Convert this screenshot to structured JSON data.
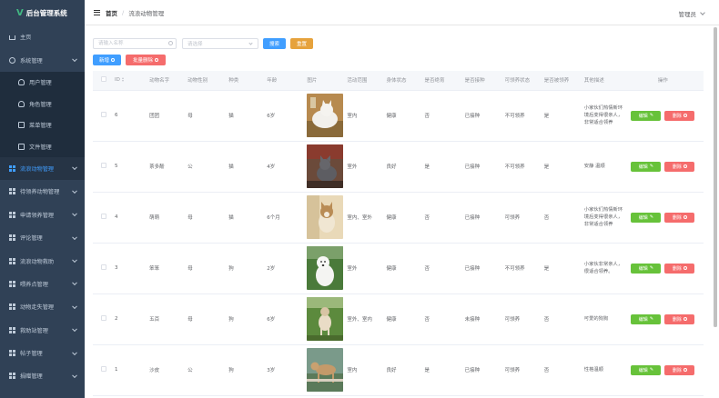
{
  "app": {
    "logo_mark": "V",
    "title": "后台管理系统"
  },
  "sidebar": {
    "items": [
      {
        "label": "主页",
        "icon": "home-icon"
      },
      {
        "label": "系统管理",
        "icon": "gear-icon",
        "expanded": true
      },
      {
        "label": "用户管理",
        "icon": "user-icon",
        "sub": true
      },
      {
        "label": "角色管理",
        "icon": "user-icon",
        "sub": true
      },
      {
        "label": "菜单管理",
        "icon": "doc-icon",
        "sub": true
      },
      {
        "label": "文件管理",
        "icon": "doc-icon",
        "sub": true
      },
      {
        "label": "流浪动物管理",
        "icon": "grid-icon",
        "active": true
      },
      {
        "label": "待领养动物管理",
        "icon": "grid-icon"
      },
      {
        "label": "申请领养管理",
        "icon": "grid-icon"
      },
      {
        "label": "评论管理",
        "icon": "grid-icon"
      },
      {
        "label": "流浪动物救助",
        "icon": "grid-icon"
      },
      {
        "label": "喂养点管理",
        "icon": "grid-icon"
      },
      {
        "label": "动物走失管理",
        "icon": "grid-icon"
      },
      {
        "label": "救助站管理",
        "icon": "grid-icon"
      },
      {
        "label": "帖子管理",
        "icon": "grid-icon"
      },
      {
        "label": "捐赠管理",
        "icon": "grid-icon"
      }
    ]
  },
  "header": {
    "breadcrumb_home": "首页",
    "breadcrumb_sep": "/",
    "breadcrumb_current": "流浪动物管理",
    "user": "管理员"
  },
  "toolbar": {
    "search_placeholder": "请输入名称",
    "select_placeholder": "请选择",
    "search_label": "搜索",
    "reset_label": "重置",
    "add_label": "新增",
    "batch_delete_label": "批量删除"
  },
  "table": {
    "columns": [
      "ID",
      "动物名字",
      "动物性别",
      "种类",
      "年龄",
      "图片",
      "活动范围",
      "身体状态",
      "是否绝育",
      "是否接种",
      "可领养状态",
      "是否被领养",
      "其他描述",
      "操作"
    ],
    "edit_label": "编辑",
    "delete_label": "删除",
    "rows": [
      {
        "id": "6",
        "name": "团团",
        "gender": "母",
        "species": "猫",
        "age": "6岁",
        "photo": "white-cat",
        "range": "室内",
        "health": "健康",
        "neutered": "否",
        "vaccinated": "已接种",
        "adoptable": "不可领养",
        "adopted": "是",
        "desc": "小家伙们热情新环境后变得很亲人，非常适合领养"
      },
      {
        "id": "5",
        "name": "茶多酚",
        "gender": "公",
        "species": "猫",
        "age": "4岁",
        "photo": "grey-cat",
        "range": "室外",
        "health": "良好",
        "neutered": "是",
        "vaccinated": "已接种",
        "adoptable": "不可领养",
        "adopted": "是",
        "desc": "安静 温顺"
      },
      {
        "id": "4",
        "name": "萌萌",
        "gender": "母",
        "species": "猫",
        "age": "6个月",
        "photo": "kitten",
        "range": "室内、室外",
        "health": "健康",
        "neutered": "否",
        "vaccinated": "已接种",
        "adoptable": "可领养",
        "adopted": "否",
        "desc": "小家伙们热情新环境后变得很亲人，非常适合领养"
      },
      {
        "id": "3",
        "name": "笨笨",
        "gender": "母",
        "species": "狗",
        "age": "2岁",
        "photo": "white-dog",
        "range": "室外",
        "health": "健康",
        "neutered": "否",
        "vaccinated": "已接种",
        "adoptable": "不可领养",
        "adopted": "是",
        "desc": "小家伙非常亲人，很适合领养。"
      },
      {
        "id": "2",
        "name": "五百",
        "gender": "母",
        "species": "狗",
        "age": "6岁",
        "photo": "brown-dog",
        "range": "室外、室内",
        "health": "健康",
        "neutered": "否",
        "vaccinated": "未接种",
        "adoptable": "可领养",
        "adopted": "否",
        "desc": "可爱的狗狗"
      },
      {
        "id": "1",
        "name": "沙皮",
        "gender": "公",
        "species": "狗",
        "age": "3岁",
        "photo": "tan-dog",
        "range": "室内",
        "health": "良好",
        "neutered": "是",
        "vaccinated": "已接种",
        "adoptable": "可领养",
        "adopted": "否",
        "desc": "性格温顺"
      }
    ]
  },
  "colors": {
    "sidebar_bg": "#304156",
    "primary": "#409eff",
    "success": "#67c23a",
    "warning": "#e6a23c",
    "danger": "#f56c6c"
  }
}
